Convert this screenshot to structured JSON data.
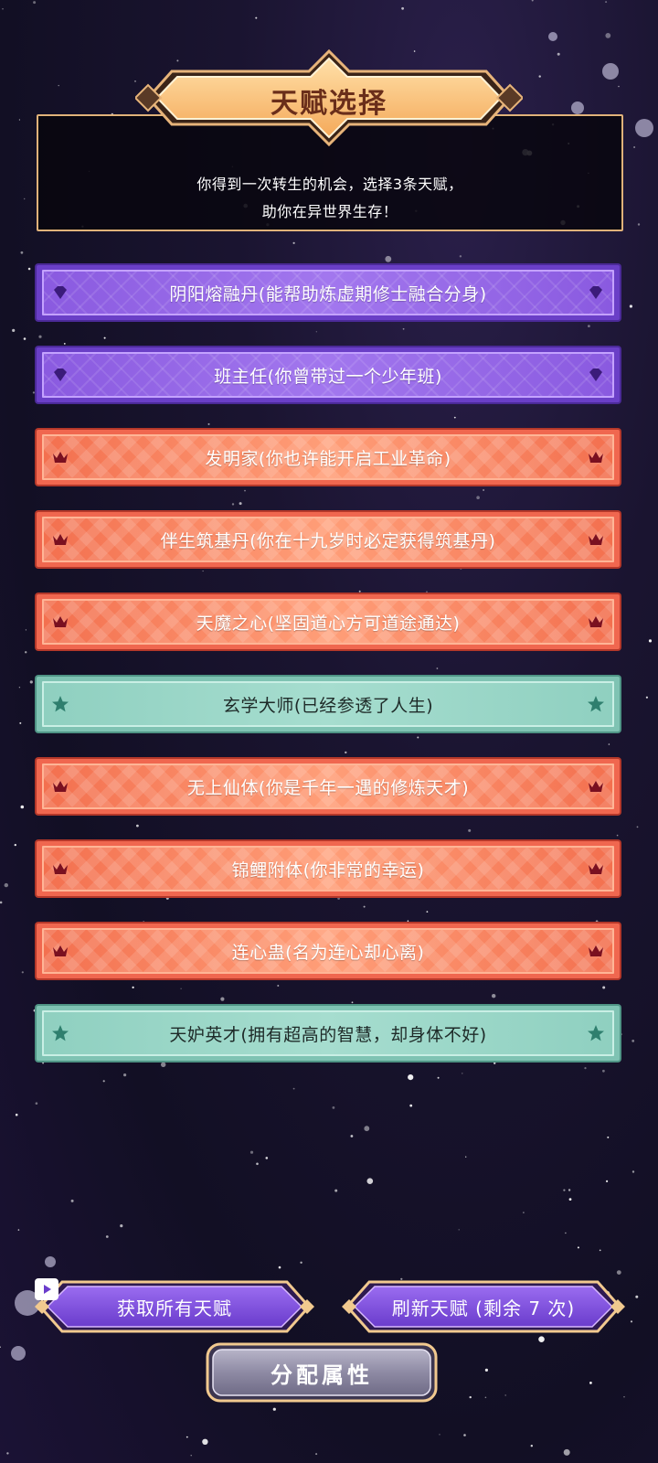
{
  "header": {
    "title": "天赋选择",
    "subtitle_line1": "你得到一次转生的机会，选择3条天赋，",
    "subtitle_line2": "助你在异世界生存！"
  },
  "talents": [
    {
      "label": "阴阳熔融丹(能帮助炼虚期修士融合分身)",
      "rarity": "purple",
      "icon": "diamond-icon"
    },
    {
      "label": "班主任(你曾带过一个少年班)",
      "rarity": "purple",
      "icon": "diamond-icon"
    },
    {
      "label": "发明家(你也许能开启工业革命)",
      "rarity": "orange",
      "icon": "crown-icon"
    },
    {
      "label": "伴生筑基丹(你在十九岁时必定获得筑基丹)",
      "rarity": "orange",
      "icon": "crown-icon"
    },
    {
      "label": "天魔之心(坚固道心方可道途通达)",
      "rarity": "orange",
      "icon": "crown-icon"
    },
    {
      "label": "玄学大师(已经参透了人生)",
      "rarity": "teal",
      "icon": "star-icon"
    },
    {
      "label": "无上仙体(你是千年一遇的修炼天才)",
      "rarity": "orange",
      "icon": "crown-icon"
    },
    {
      "label": "锦鲤附体(你非常的幸运)",
      "rarity": "orange",
      "icon": "crown-icon"
    },
    {
      "label": "连心蛊(名为连心却心离)",
      "rarity": "orange",
      "icon": "crown-icon"
    },
    {
      "label": "天妒英才(拥有超高的智慧，却身体不好)",
      "rarity": "teal",
      "icon": "star-icon"
    }
  ],
  "buttons": {
    "get_all": "获取所有天赋",
    "refresh": "刷新天赋 (剩余 7 次)",
    "allocate": "分配属性"
  },
  "colors": {
    "purple": "#8a5ae0",
    "orange": "#f3704f",
    "teal": "#8fd0c0",
    "gold_border": "#e0b27a",
    "button_purple": "#7a48d6"
  }
}
